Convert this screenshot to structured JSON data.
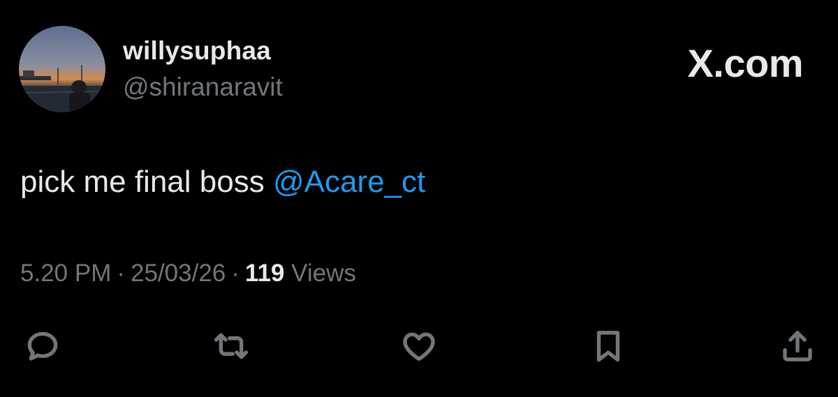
{
  "author": {
    "display_name": "willysuphaa",
    "handle": "@shiranaravit",
    "avatar_icon": "avatar-photo"
  },
  "brand": {
    "label": "X.com"
  },
  "tweet": {
    "text": "pick me final boss ",
    "mention": "@Acare_ct"
  },
  "meta": {
    "time": "5.20 PM",
    "separator": "·",
    "date": "25/03/26",
    "views_count": "119",
    "views_label": "Views"
  },
  "actions": [
    {
      "name": "reply",
      "icon": "reply-icon"
    },
    {
      "name": "retweet",
      "icon": "retweet-icon"
    },
    {
      "name": "like",
      "icon": "heart-icon"
    },
    {
      "name": "bookmark",
      "icon": "bookmark-icon"
    },
    {
      "name": "share",
      "icon": "share-icon"
    }
  ],
  "colors": {
    "background": "#000000",
    "primary_text": "#e7e9ea",
    "secondary_text": "#71767b",
    "link": "#1d9bf0"
  }
}
